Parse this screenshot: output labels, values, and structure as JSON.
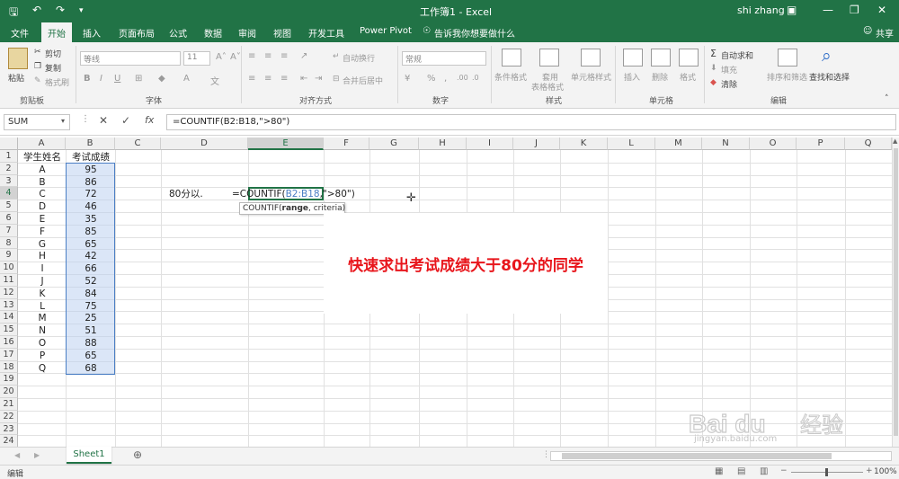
{
  "titlebar": {
    "title": "工作簿1 - Excel",
    "user": "shi zhang"
  },
  "tabs": [
    "文件",
    "开始",
    "插入",
    "页面布局",
    "公式",
    "数据",
    "审阅",
    "视图",
    "开发工具",
    "Power Pivot"
  ],
  "tell_me": "告诉我你想要做什么",
  "share": "共享",
  "ribbon": {
    "paste": "粘贴",
    "cut": "剪切",
    "copy": "复制",
    "format_painter": "格式刷",
    "font_name": "等线",
    "font_size": "11",
    "wrap_text": "自动换行",
    "merge_center": "合并后居中",
    "number_format": "常规",
    "cond_format": "条件格式",
    "table_format_1": "套用",
    "table_format_2": "表格格式",
    "cell_styles": "单元格样式",
    "insert": "插入",
    "delete": "删除",
    "format": "格式",
    "autosum": "自动求和",
    "fill": "填充",
    "clear": "清除",
    "sort_filter": "排序和筛选",
    "find_select": "查找和选择",
    "groups": {
      "clipboard": "剪贴板",
      "font": "字体",
      "alignment": "对齐方式",
      "number": "数字",
      "styles": "样式",
      "cells": "单元格",
      "editing": "编辑"
    }
  },
  "formula_bar": {
    "name_box": "SUM",
    "formula": "=COUNTIF(B2:B18,\">80\")"
  },
  "columns": [
    "A",
    "B",
    "C",
    "D",
    "E",
    "F",
    "G",
    "H",
    "I",
    "J",
    "K",
    "L",
    "M",
    "N",
    "O",
    "P",
    "Q"
  ],
  "rows": [
    "1",
    "2",
    "3",
    "4",
    "5",
    "6",
    "7",
    "8",
    "9",
    "10",
    "11",
    "12",
    "13",
    "14",
    "15",
    "16",
    "17",
    "18",
    "19",
    "20",
    "21",
    "22",
    "23",
    "24"
  ],
  "headers": {
    "name": "学生姓名",
    "score": "考试成绩"
  },
  "students": [
    {
      "name": "A",
      "score": "95"
    },
    {
      "name": "B",
      "score": "86"
    },
    {
      "name": "C",
      "score": "72"
    },
    {
      "name": "D",
      "score": "46"
    },
    {
      "name": "E",
      "score": "35"
    },
    {
      "name": "F",
      "score": "85"
    },
    {
      "name": "G",
      "score": "65"
    },
    {
      "name": "H",
      "score": "42"
    },
    {
      "name": "I",
      "score": "66"
    },
    {
      "name": "J",
      "score": "52"
    },
    {
      "name": "K",
      "score": "84"
    },
    {
      "name": "L",
      "score": "75"
    },
    {
      "name": "M",
      "score": "25"
    },
    {
      "name": "N",
      "score": "51"
    },
    {
      "name": "O",
      "score": "88"
    },
    {
      "name": "P",
      "score": "65"
    },
    {
      "name": "Q",
      "score": "68"
    }
  ],
  "d4_label": "80分以.",
  "e4_formula": {
    "prefix": "=COUNTIF(",
    "range": "B2:B18",
    "suffix": ",\">80\")"
  },
  "tooltip": {
    "fn": "COUNTIF(",
    "arg1": "range",
    "rest": ", criteria)"
  },
  "annotation": "快速求出考试成绩大于80分的同学",
  "sheet_tab": "Sheet1",
  "status": {
    "mode": "编辑",
    "zoom": "100%"
  },
  "watermark": {
    "logo": "Baidu经验",
    "url": "jingyan.baidu.com"
  },
  "colors": {
    "excel_green": "#217346",
    "annotation_red": "#e8161c",
    "range_blue": "#4a7ec4"
  }
}
